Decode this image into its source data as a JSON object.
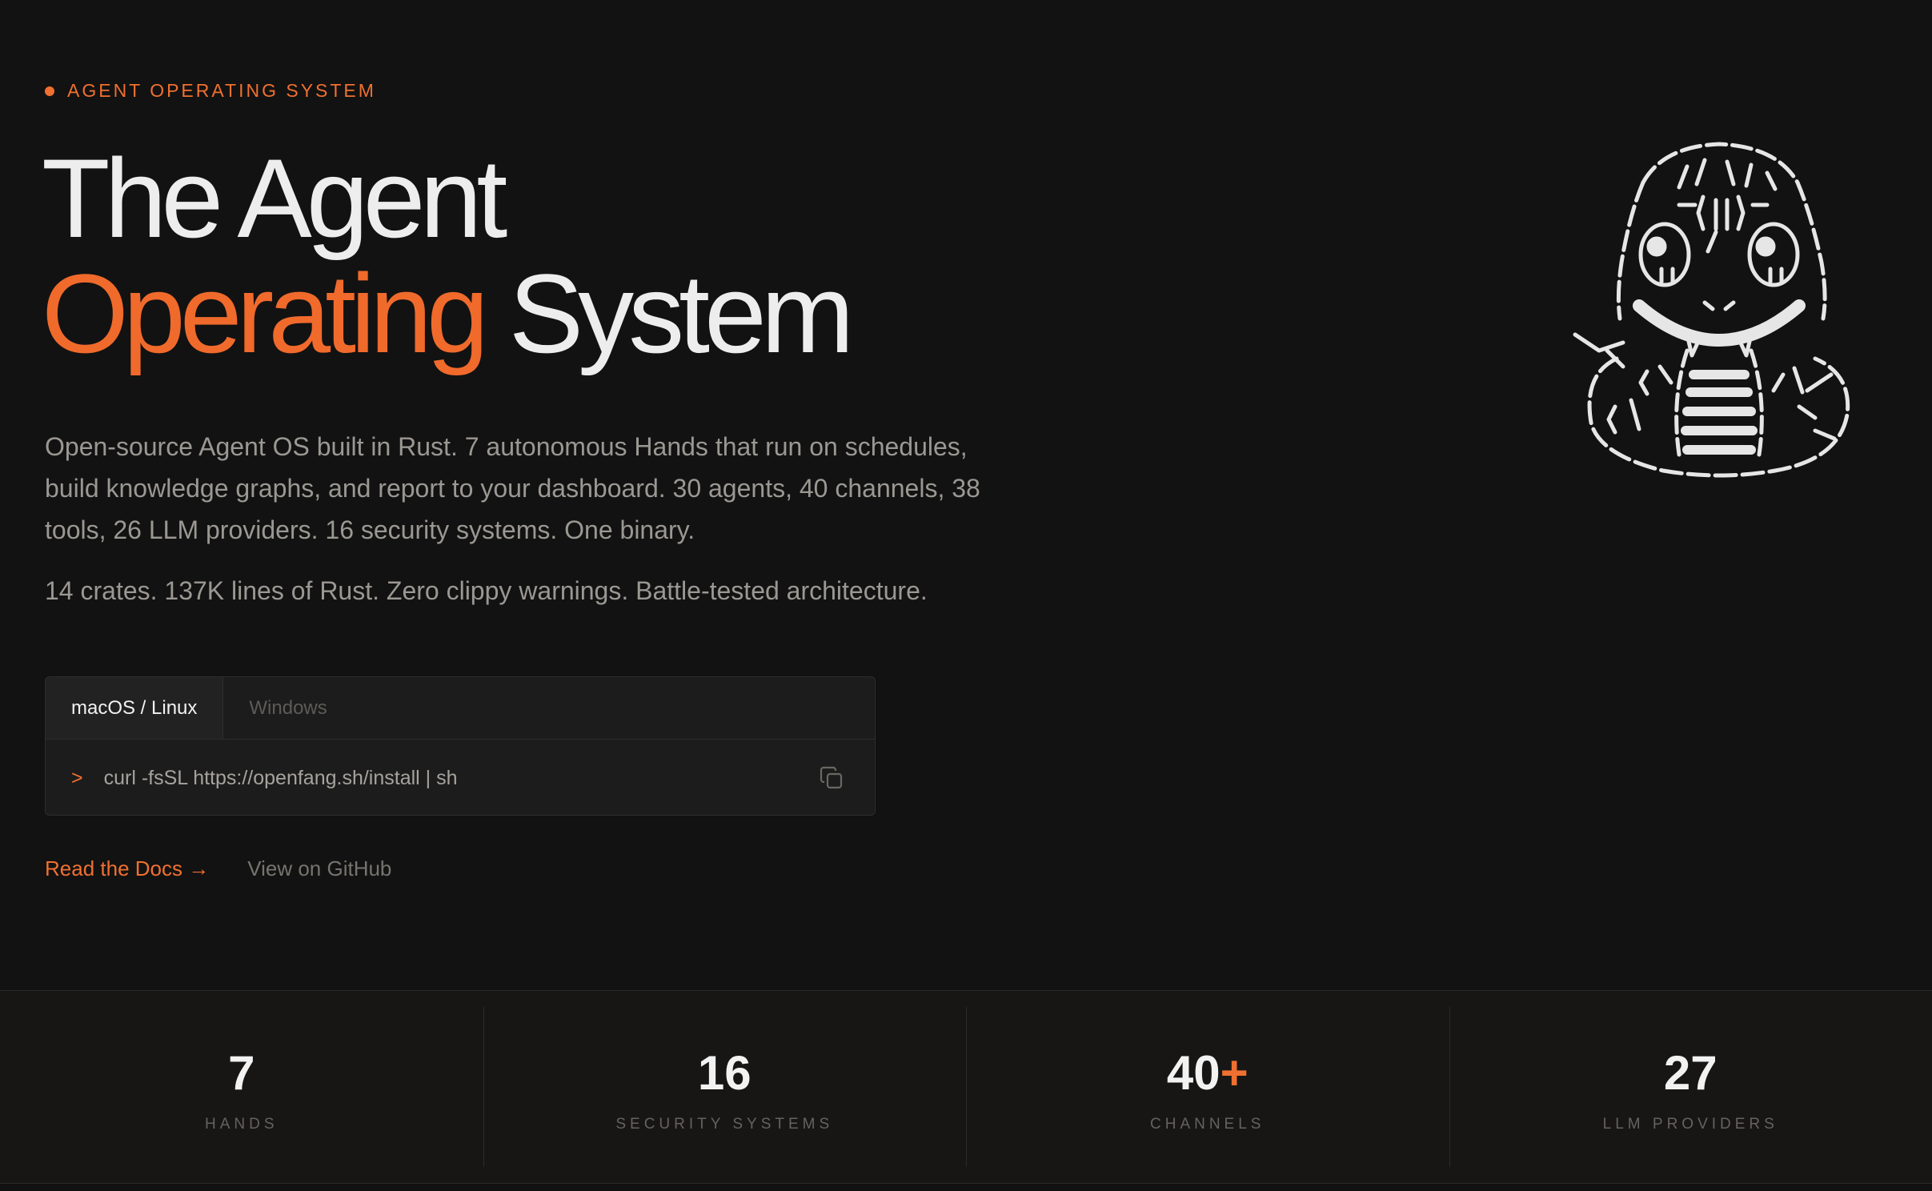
{
  "hero": {
    "eyebrow": "AGENT OPERATING SYSTEM",
    "headline_line1": "The Agent",
    "headline_accent": "Operating",
    "headline_rest": "System",
    "description": "Open-source Agent OS built in Rust. 7 autonomous Hands that run on schedules, build knowledge graphs, and report to your dashboard. 30 agents, 40 channels, 38 tools, 26 LLM providers. 16 security systems. One binary.",
    "description2": "14 crates. 137K lines of Rust. Zero clippy warnings. Battle-tested architecture."
  },
  "install": {
    "tabs": [
      {
        "label": "macOS / Linux",
        "active": true
      },
      {
        "label": "Windows",
        "active": false
      }
    ],
    "prompt": ">",
    "command": "curl -fsSL https://openfang.sh/install | sh",
    "copy_icon": "copy-icon"
  },
  "links": {
    "docs": "Read the Docs →",
    "github": "View on GitHub"
  },
  "stats": [
    {
      "value": "7",
      "suffix": "",
      "label": "HANDS"
    },
    {
      "value": "16",
      "suffix": "",
      "label": "SECURITY SYSTEMS"
    },
    {
      "value": "40",
      "suffix": "+",
      "label": "CHANNELS"
    },
    {
      "value": "27",
      "suffix": "",
      "label": "LLM PROVIDERS"
    }
  ],
  "colors": {
    "accent": "#f07030",
    "background": "#121212",
    "text": "#ededed",
    "muted": "#9b9893"
  }
}
